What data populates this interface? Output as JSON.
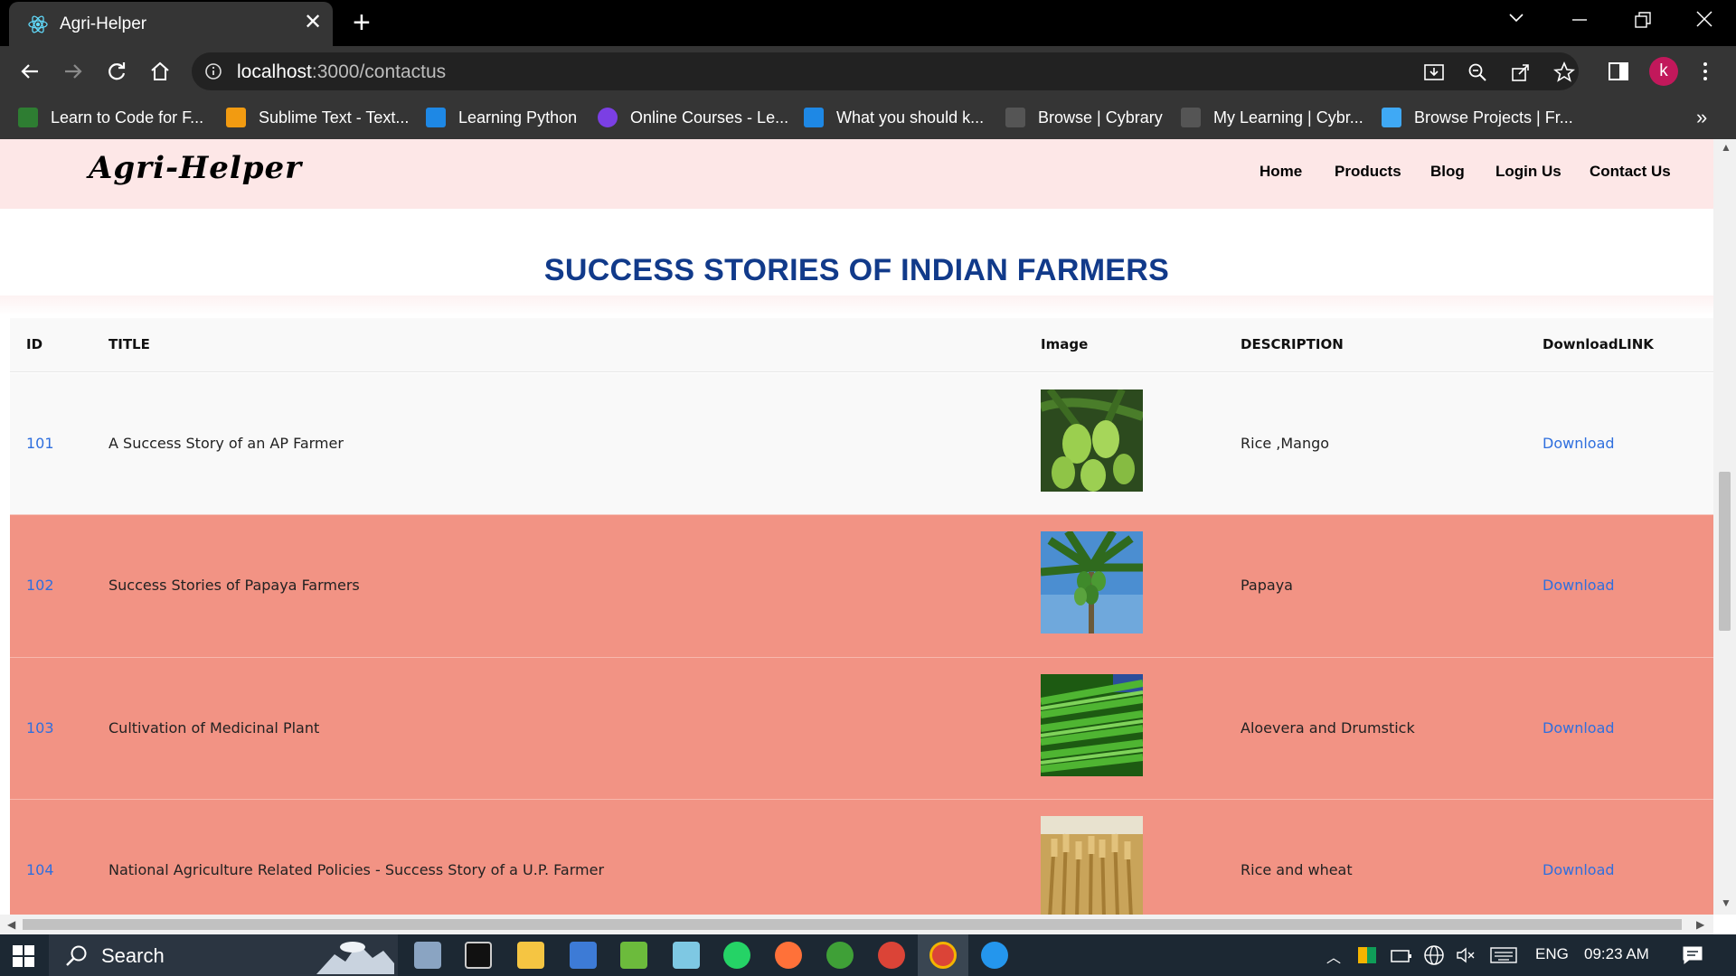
{
  "browser": {
    "tab_title": "Agri-Helper",
    "tab_close": "✕",
    "new_tab": "+",
    "url_host": "localhost",
    "url_path": ":3000/contactus",
    "avatar_letter": "k",
    "bookmarks_more": "»",
    "bookmarks": [
      {
        "label": "Learn to Code for F...",
        "color": "#2e7d32"
      },
      {
        "label": "Sublime Text - Text...",
        "color": "#f29b11"
      },
      {
        "label": "Learning Python",
        "color": "#1e88e5"
      },
      {
        "label": "Online Courses - Le...",
        "color": "#7b3fe4"
      },
      {
        "label": "What you should k...",
        "color": "#1e88e5"
      },
      {
        "label": "Browse | Cybrary",
        "color": "#444444"
      },
      {
        "label": "My Learning | Cybr...",
        "color": "#444444"
      },
      {
        "label": "Browse Projects | Fr...",
        "color": "#3fa9f5"
      }
    ]
  },
  "site": {
    "logo": "Agri-Helper",
    "nav": [
      "Home",
      "Products",
      "Blog",
      "Login Us",
      "Contact Us"
    ],
    "heading": "SUCCESS STORIES OF INDIAN FARMERS",
    "heading_color": "#113a8a"
  },
  "table": {
    "headers": [
      "ID",
      "TITLE",
      "Image",
      "DESCRIPTION",
      "DownloadLINK"
    ],
    "rows": [
      {
        "id": "101",
        "title": "A Success Story of an AP Farmer",
        "image": "mango-icon",
        "description": "Rice ,Mango",
        "link": "Download"
      },
      {
        "id": "102",
        "title": "Success Stories of Papaya Farmers",
        "image": "papaya-icon",
        "description": "Papaya",
        "link": "Download"
      },
      {
        "id": "103",
        "title": "Cultivation of Medicinal Plant",
        "image": "beans-icon",
        "description": "Aloevera and Drumstick",
        "link": "Download"
      },
      {
        "id": "104",
        "title": "National Agriculture Related Policies - Success Story of a U.P. Farmer",
        "image": "wheat-icon",
        "description": "Rice and wheat",
        "link": "Download"
      }
    ],
    "row_highlight_color": "#f29384"
  },
  "taskbar": {
    "search_label": "Search",
    "lang": "ENG",
    "time": "09:23 AM"
  }
}
